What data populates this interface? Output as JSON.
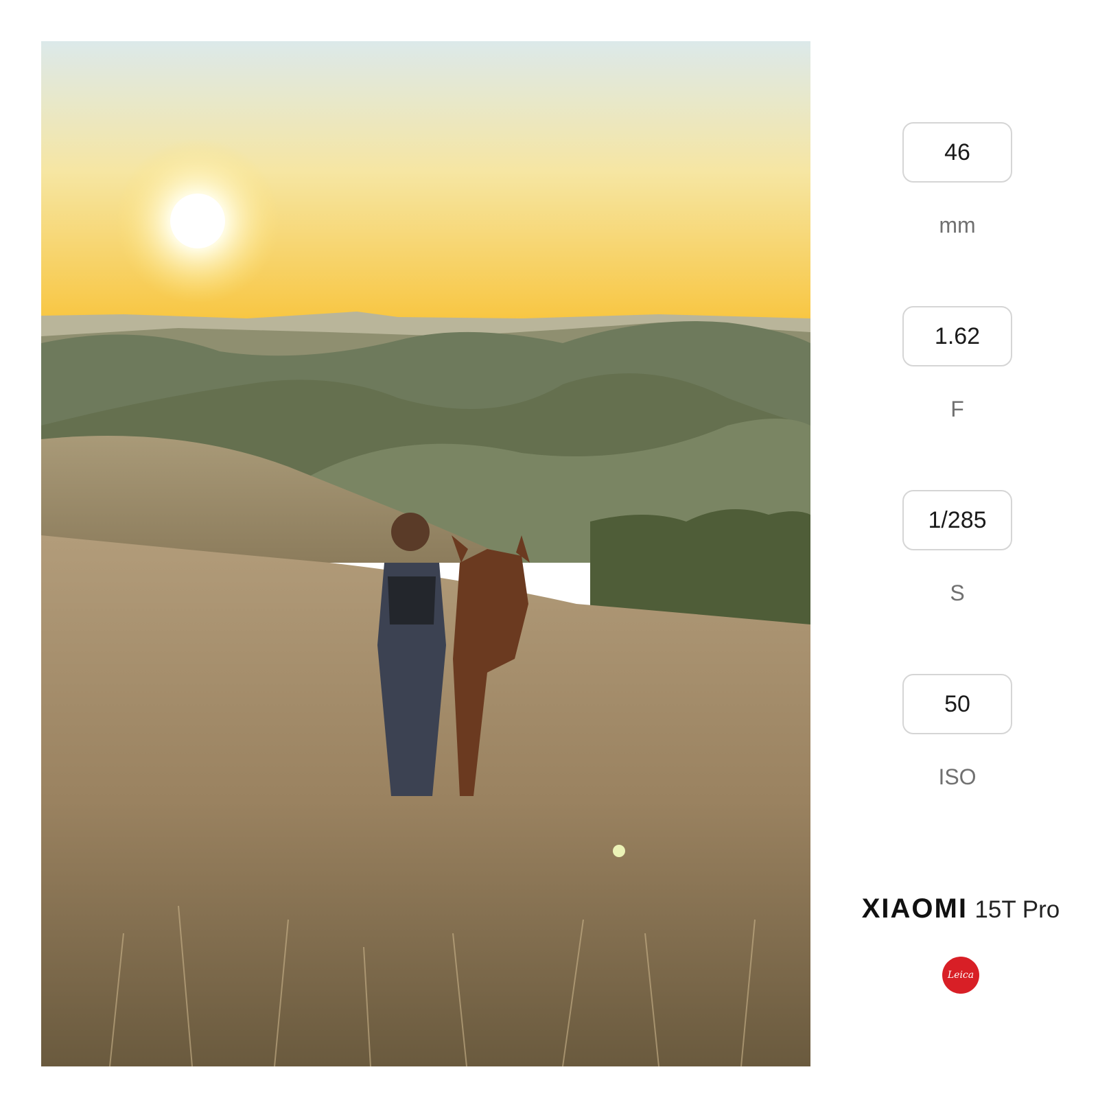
{
  "photo": {
    "scene": "woman-with-horse-on-grassy-hills-at-sunset"
  },
  "specs": [
    {
      "value": "46",
      "unit": "mm"
    },
    {
      "value": "1.62",
      "unit": "F"
    },
    {
      "value": "1/285",
      "unit": "S"
    },
    {
      "value": "50",
      "unit": "ISO"
    }
  ],
  "brand": {
    "name": "XIAOMI",
    "model": "15T Pro",
    "badge": "Leica"
  },
  "colors": {
    "sky_top": "#dde9ea",
    "sky_horizon": "#f8c43c",
    "hills": "#6e7a5c",
    "grass": "#9c8664",
    "leica_red": "#d81f26"
  }
}
